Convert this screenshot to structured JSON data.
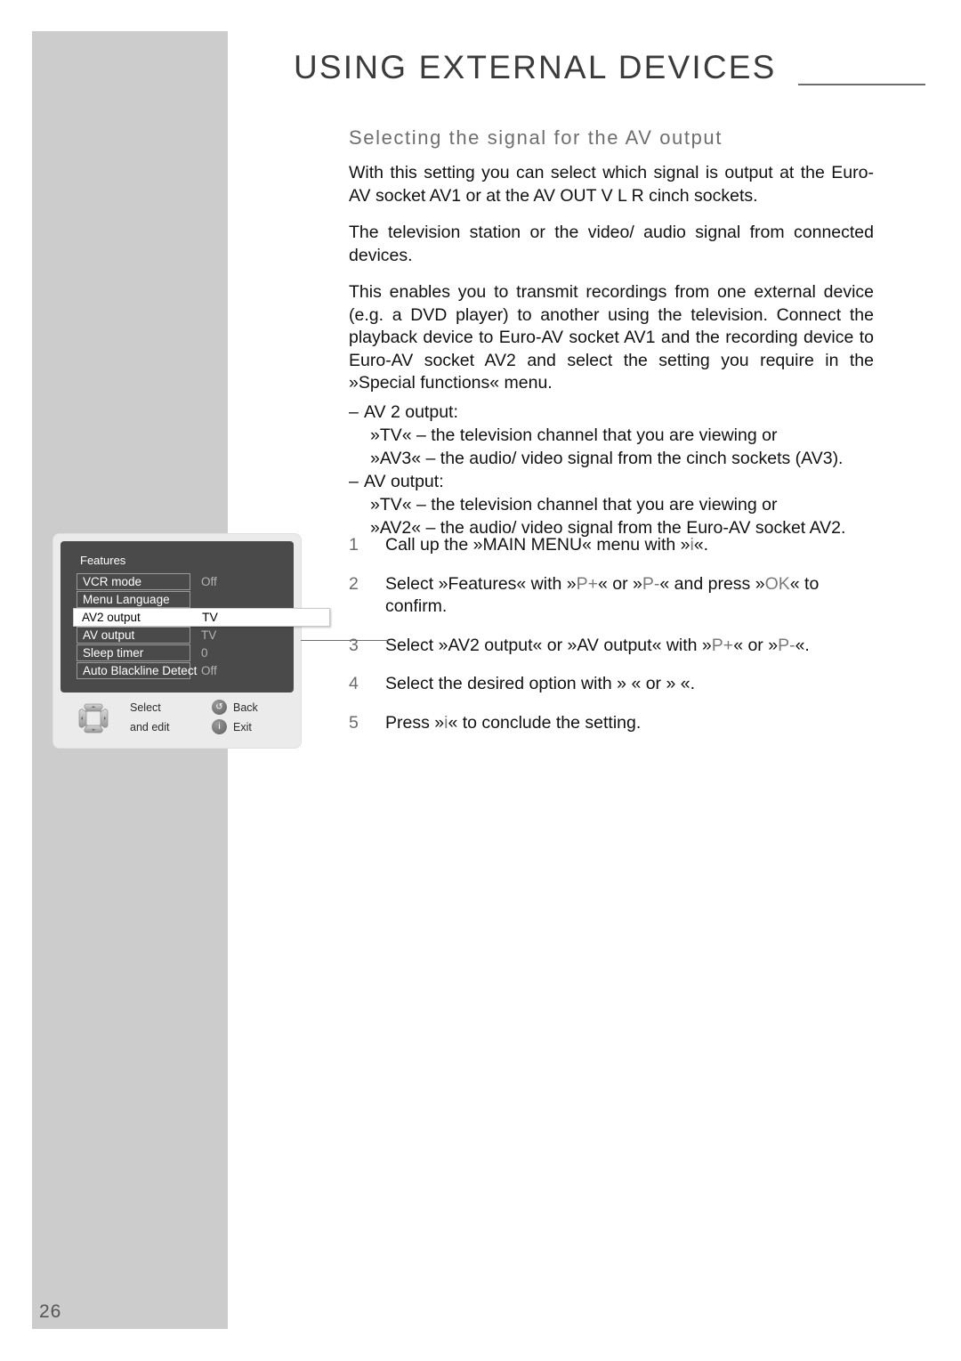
{
  "page": {
    "number": "26",
    "chapter_title": "USING EXTERNAL DEVICES",
    "section_title": "Selecting the signal for the AV output"
  },
  "paragraphs": [
    "With this setting you can select which signal is output at the Euro-AV socket AV1 or at the AV OUT V L R cinch sockets.",
    "The television station or the video/ audio signal from connected devices.",
    "This enables you to transmit recordings from one external device (e.g. a DVD player) to another using the television. Connect the playback device to Euro-AV socket AV1 and the recording device to Euro-AV socket AV2 and select the setting you require in the »Special functions« menu."
  ],
  "options": [
    {
      "heading": "AV 2 output:",
      "entries": [
        "»TV« – the television channel that you are viewing or",
        "»AV3« – the audio/ video signal from the cinch sockets (AV3)."
      ]
    },
    {
      "heading": "AV output:",
      "entries": [
        "»TV« – the television channel that you are viewing or",
        "»AV2« – the audio/ video signal from the Euro-AV socket AV2."
      ]
    }
  ],
  "steps": [
    {
      "number": "1",
      "parts": [
        {
          "text": "Call up the »MAIN MENU« menu with »",
          "key": false
        },
        {
          "text": "i",
          "key": true
        },
        {
          "text": "«.",
          "key": false
        }
      ]
    },
    {
      "number": "2",
      "parts": [
        {
          "text": "Select »Features« with »",
          "key": false
        },
        {
          "text": "P+",
          "key": true
        },
        {
          "text": "« or »",
          "key": false
        },
        {
          "text": "P-",
          "key": true
        },
        {
          "text": "« and press »",
          "key": false
        },
        {
          "text": "OK",
          "key": true
        },
        {
          "text": "« to confirm.",
          "key": false
        }
      ]
    },
    {
      "number": "3",
      "parts": [
        {
          "text": "Select »AV2 output« or »AV output« with »",
          "key": false
        },
        {
          "text": "P+",
          "key": true
        },
        {
          "text": "« or »",
          "key": false
        },
        {
          "text": "P-",
          "key": true
        },
        {
          "text": "«.",
          "key": false
        }
      ]
    },
    {
      "number": "4",
      "parts": [
        {
          "text": "Select the desired option with »",
          "key": false
        },
        {
          "text": "   ",
          "key": true
        },
        {
          "text": "« or »",
          "key": false
        },
        {
          "text": "   ",
          "key": true
        },
        {
          "text": "«.",
          "key": false
        }
      ]
    },
    {
      "number": "5",
      "parts": [
        {
          "text": "Press »",
          "key": false
        },
        {
          "text": "i",
          "key": true
        },
        {
          "text": "« to conclude the setting.",
          "key": false
        }
      ]
    }
  ],
  "tv_menu": {
    "heading": "Features",
    "rows": [
      {
        "label": "VCR mode",
        "value": "Off",
        "selected": false
      },
      {
        "label": "Menu Language",
        "value": "",
        "selected": false
      },
      {
        "label": "AV2 output",
        "value": "TV",
        "selected": true
      },
      {
        "label": "AV output",
        "value": "TV",
        "selected": false
      },
      {
        "label": "Sleep timer",
        "value": "0",
        "selected": false
      },
      {
        "label": "Auto Blackline Detect",
        "value": "Off",
        "selected": false
      }
    ],
    "hints": {
      "select": "Select",
      "and_edit": "and edit",
      "back": "Back",
      "exit": "Exit"
    }
  },
  "colors": {
    "sidebar": "#cccccc",
    "panel": "#4a4a4a",
    "key_text": "#7a7a7a",
    "heading": "#3b3b3b"
  }
}
